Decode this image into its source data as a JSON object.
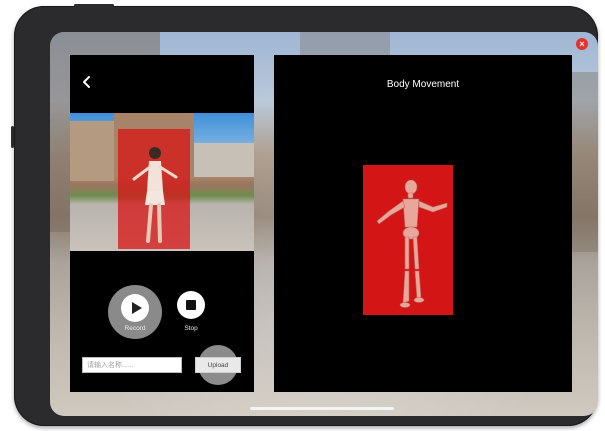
{
  "window": {
    "close_glyph": "×"
  },
  "left_panel": {
    "back_icon": "chevron-left-icon",
    "controls": {
      "record_label": "Record",
      "stop_label": "Stop"
    },
    "name_input": {
      "value": "",
      "placeholder": "请输入名称......"
    },
    "upload_label": "Upload"
  },
  "right_panel": {
    "title": "Body Movement",
    "model_icon": "mannequin-figure"
  },
  "colors": {
    "panel_bg": "#000000",
    "highlight_red": "#d41515",
    "close_red": "#e5322d",
    "record_button_gray": "#8a8a8a"
  }
}
